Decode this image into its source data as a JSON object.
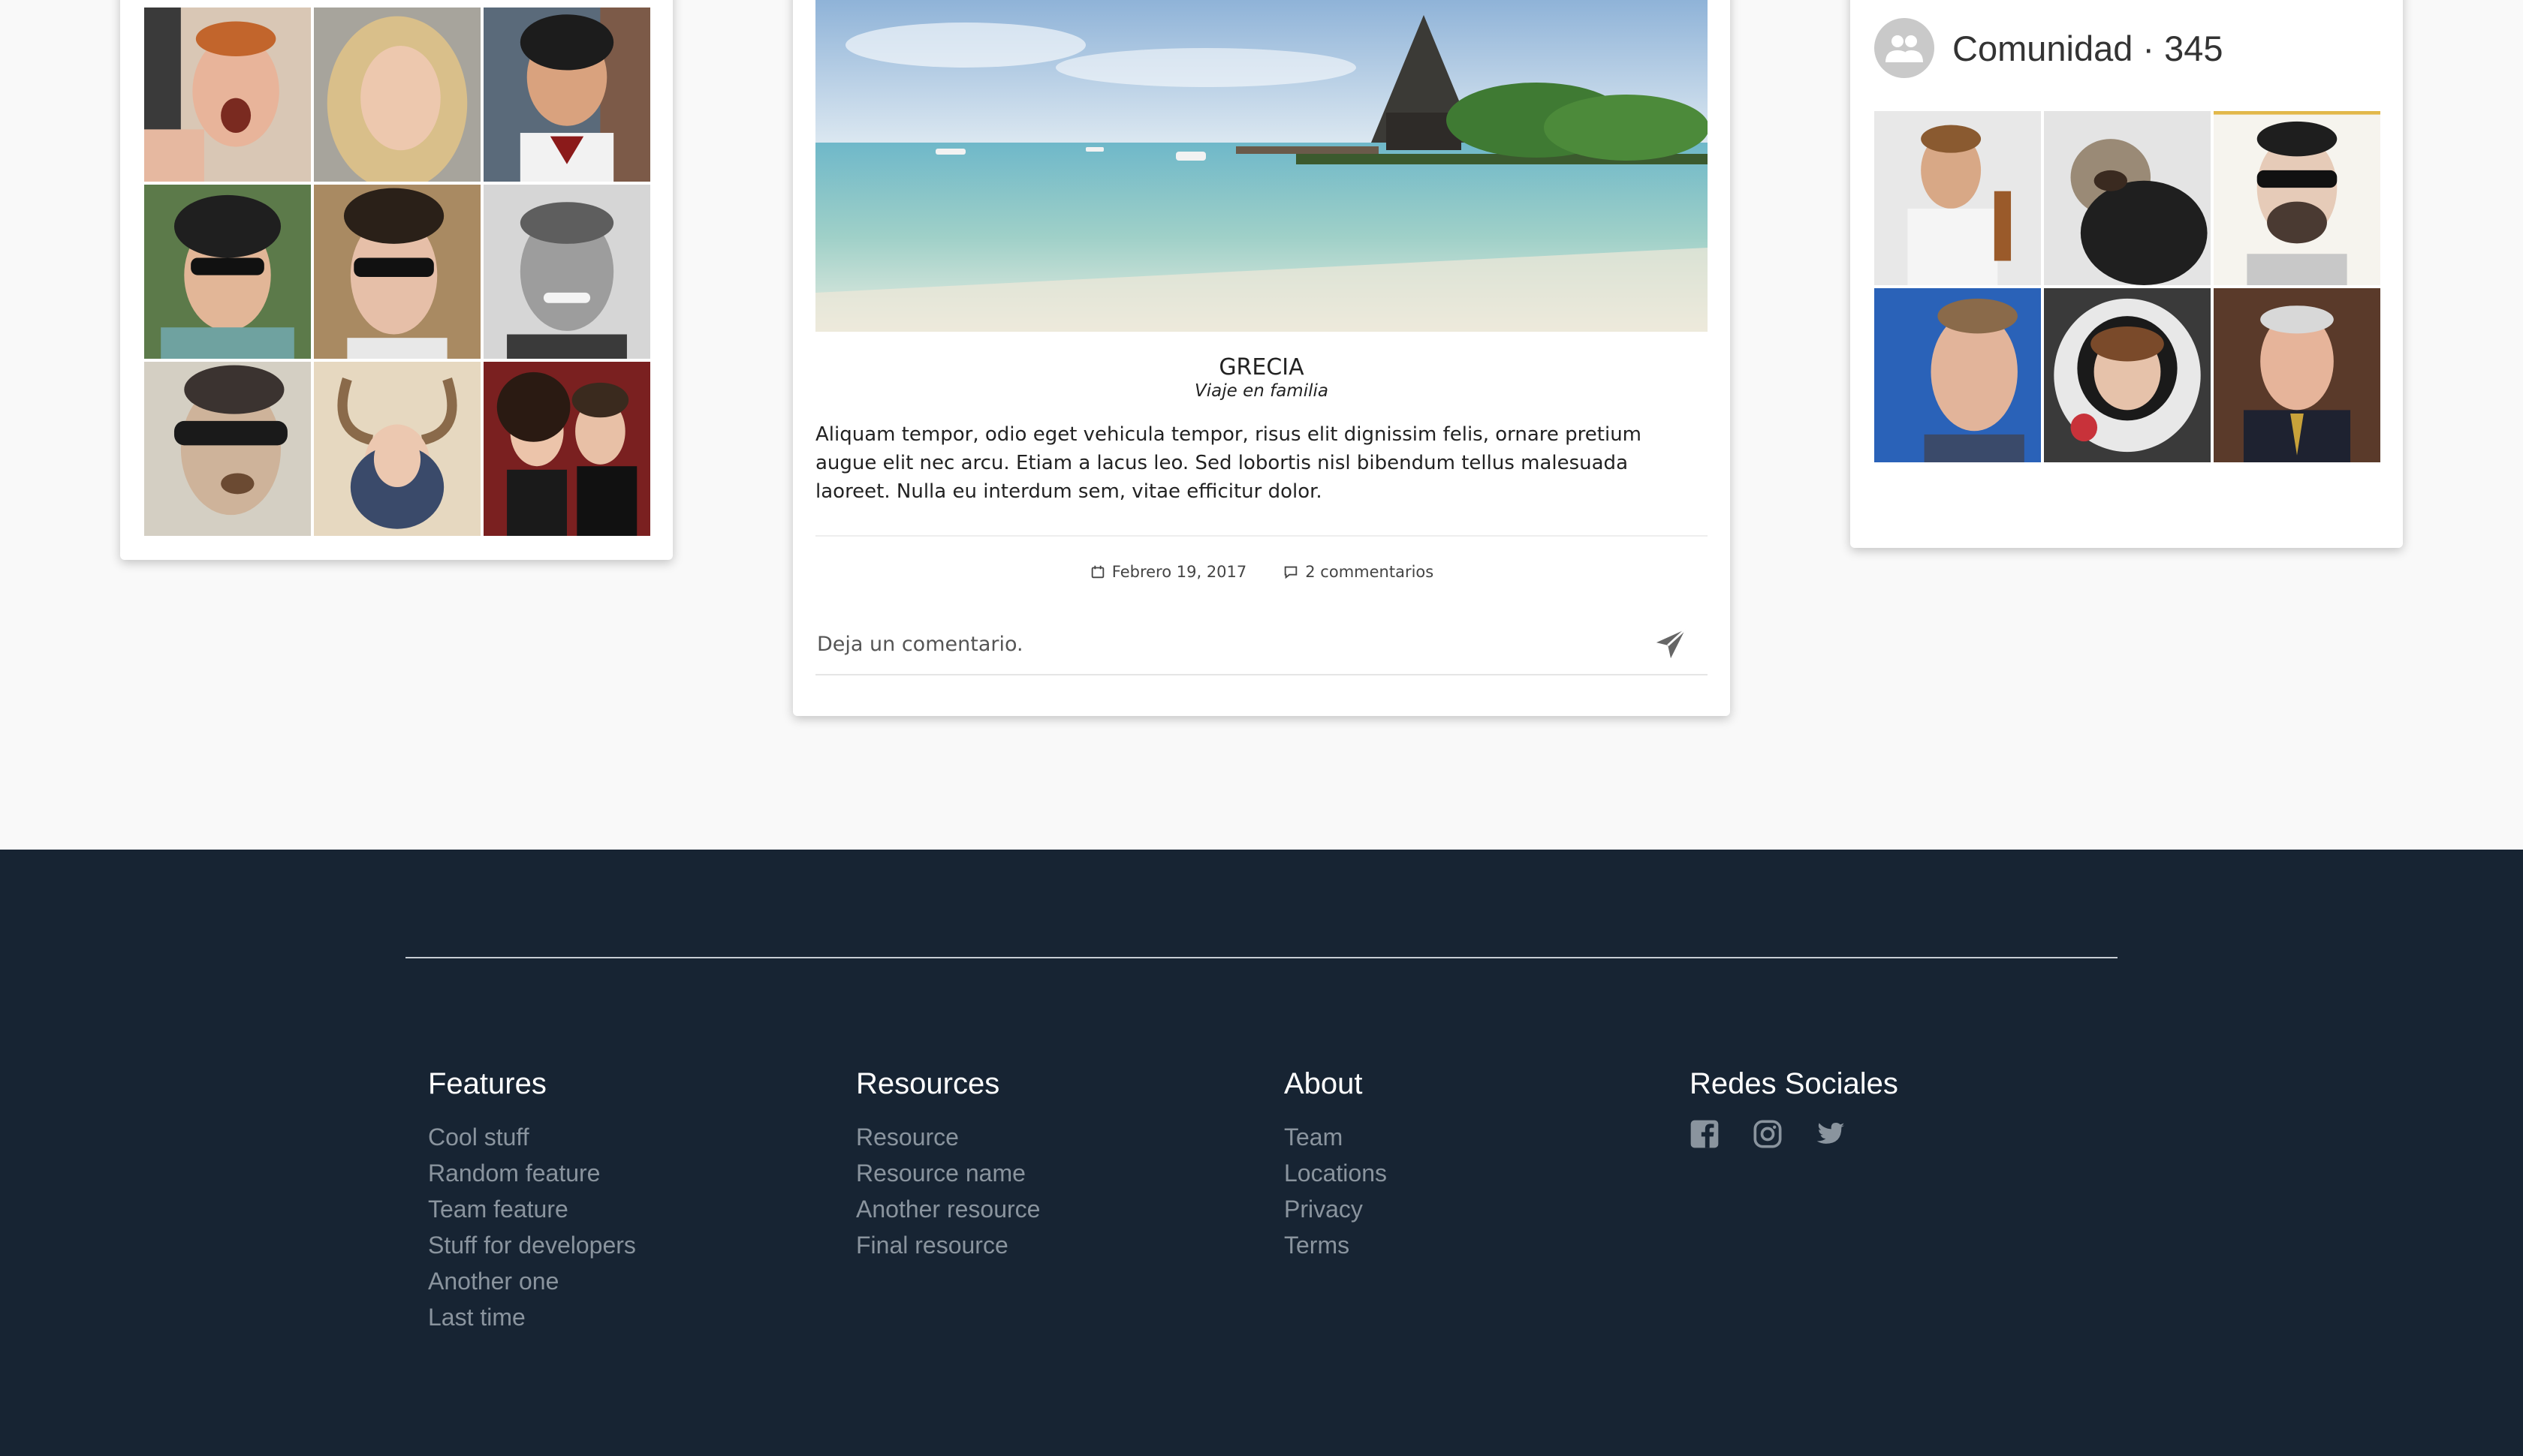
{
  "post": {
    "title": "GRECIA",
    "subtitle": "Viaje en familia",
    "body": "Aliquam tempor, odio eget vehicula tempor, risus elit dignissim felis, ornare pretium augue elit nec arcu. Etiam a lacus leo. Sed lobortis nisl bibendum tellus malesuada laoreet. Nulla eu interdum sem, vitae efficitur dolor.",
    "date": "Febrero 19, 2017",
    "comments": "2 commentarios",
    "comment_placeholder": "Deja un comentario."
  },
  "community": {
    "title": "Comunidad · 345"
  },
  "footer": {
    "columns": [
      {
        "title": "Features",
        "items": [
          "Cool stuff",
          "Random feature",
          "Team feature",
          "Stuff for developers",
          "Another one",
          "Last time"
        ]
      },
      {
        "title": "Resources",
        "items": [
          "Resource",
          "Resource name",
          "Another resource",
          "Final resource"
        ]
      },
      {
        "title": "About",
        "items": [
          "Team",
          "Locations",
          "Privacy",
          "Terms"
        ]
      },
      {
        "title": "Redes Sociales",
        "icons": [
          "facebook-icon",
          "instagram-icon",
          "twitter-icon"
        ]
      }
    ]
  },
  "colors": {
    "footer_bg": "#172433",
    "footer_link": "#8a949e",
    "page_bg": "#f9f9f9"
  }
}
